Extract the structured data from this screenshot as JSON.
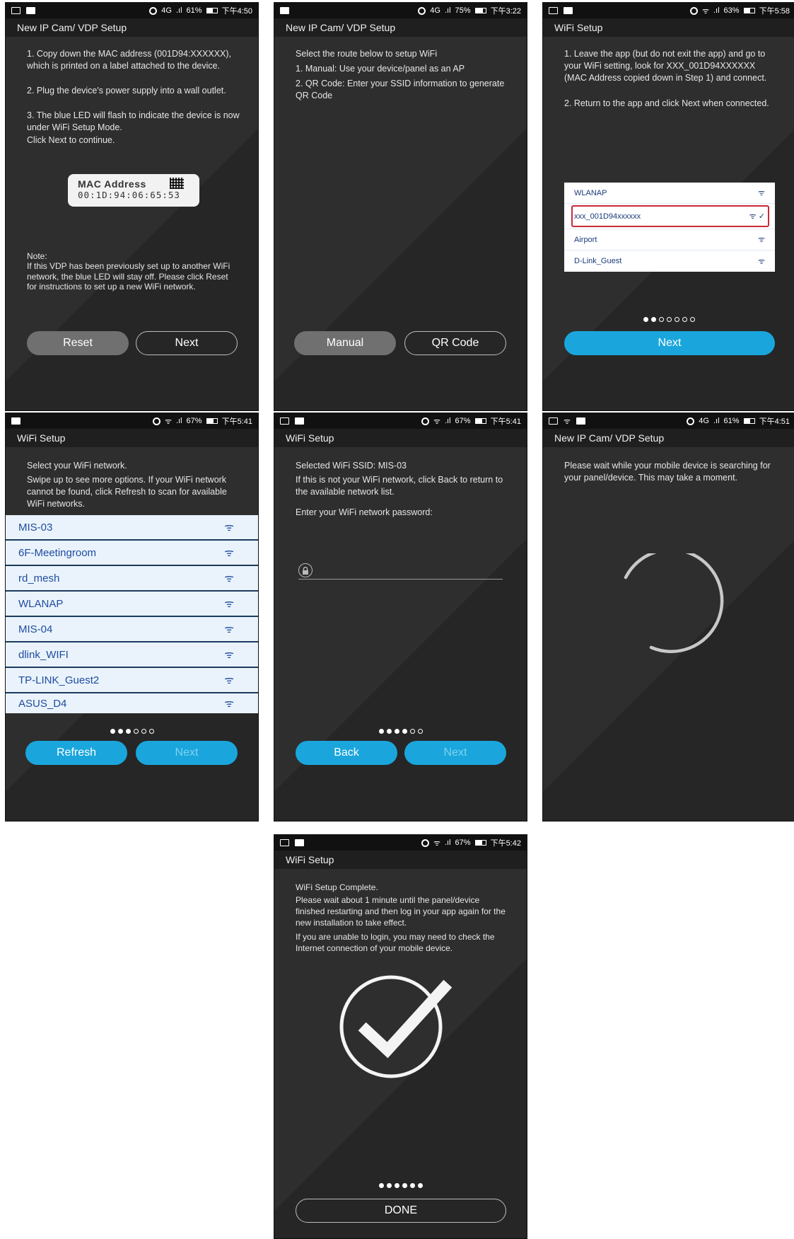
{
  "screens": [
    {
      "status": {
        "signal": "4G",
        "battery": "61%",
        "time": "下午4:50"
      },
      "title": "New IP Cam/ VDP Setup",
      "lines": [
        "1. Copy down the MAC address (001D94:XXXXXX), which is printed on a label attached to the device.",
        "2. Plug the device's power supply into a wall outlet.",
        "3. The blue LED will flash to indicate the device is now under WiFi Setup Mode.",
        "Click Next to continue."
      ],
      "mac_label": "MAC Address",
      "mac_value": "00:1D:94:06:65:53",
      "note_title": "Note:",
      "note": "If this VDP has been previously set up to another WiFi network, the blue LED will stay off. Please click Reset for instructions to set up a new WiFi network.",
      "btn_left": "Reset",
      "btn_right": "Next"
    },
    {
      "status": {
        "signal": "4G",
        "battery": "75%",
        "time": "下午3:22"
      },
      "title": "New IP Cam/ VDP Setup",
      "lines": [
        "Select the route below to setup WiFi",
        "1. Manual: Use your device/panel as an AP",
        "2. QR Code: Enter your SSID information to generate QR Code"
      ],
      "btn_left": "Manual",
      "btn_right": "QR Code"
    },
    {
      "status": {
        "battery": "63%",
        "time": "下午5:58"
      },
      "title": "WiFi Setup",
      "lines": [
        "1. Leave the app (but do not exit the app) and go to your WiFi setting, look for XXX_001D94XXXXXX (MAC Address copied down in Step 1) and connect.",
        "2. Return to the app and click Next when connected."
      ],
      "networks": [
        "WLANAP",
        "xxx_001D94xxxxxx",
        "Airport",
        "D-Link_Guest"
      ],
      "button": "Next"
    },
    {
      "status": {
        "battery": "67%",
        "time": "下午5:41"
      },
      "title": "WiFi Setup",
      "lines": [
        "Select your WiFi network.",
        "Swipe up to see more options. If your WiFi network cannot be found, click Refresh to scan for available WiFi networks."
      ],
      "networks": [
        "MIS-03",
        "6F-Meetingroom",
        "rd_mesh",
        "WLANAP",
        "MIS-04",
        "dlink_WIFI",
        "TP-LINK_Guest2",
        "ASUS_D4"
      ],
      "btn_left": "Refresh",
      "btn_right": "Next"
    },
    {
      "status": {
        "battery": "67%",
        "time": "下午5:41"
      },
      "title": "WiFi Setup",
      "lines": [
        "Selected WiFi SSID: MIS-03",
        "If this is not your WiFi network, click Back to return to the available network list.",
        "Enter your WiFi network password:"
      ],
      "btn_left": "Back",
      "btn_right": "Next"
    },
    {
      "status": {
        "signal": "4G",
        "battery": "61%",
        "time": "下午4:51"
      },
      "title": "New IP Cam/ VDP Setup",
      "lines": [
        "Please wait while your mobile device is searching for your panel/device. This may take a moment."
      ]
    },
    {
      "status": {
        "battery": "67%",
        "time": "下午5:42"
      },
      "title": "WiFi Setup",
      "lines": [
        "WiFi Setup Complete.",
        "Please wait about 1 minute until the panel/device finished restarting and then log in your app again for the new installation to take effect.",
        "If you are unable to login, you may need to check the Internet connection of your mobile device."
      ],
      "button": "DONE"
    }
  ],
  "colors": {
    "accent": "#1aa6dc",
    "highlight": "#c62b3a",
    "bg": "#2b2b2b"
  }
}
